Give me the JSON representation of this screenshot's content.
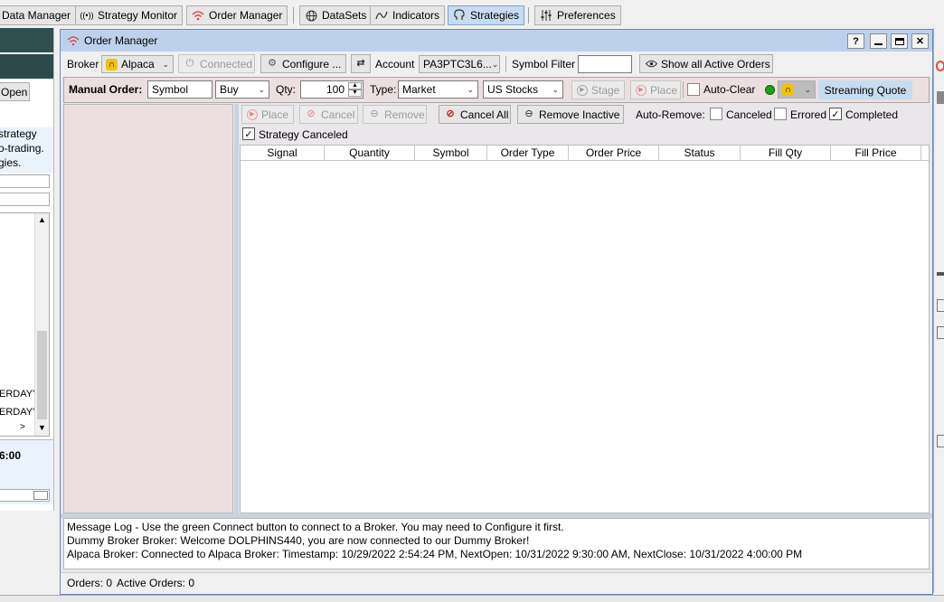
{
  "toolbar": {
    "items": [
      {
        "label": "Data Manager",
        "icon": "database-icon"
      },
      {
        "label": "Strategy Monitor",
        "icon": "broadcast-icon"
      },
      {
        "label": "Order Manager",
        "icon": "wifi-icon"
      },
      {
        "label": "DataSets",
        "icon": "globe-icon"
      },
      {
        "label": "Indicators",
        "icon": "wave-icon"
      },
      {
        "label": "Strategies",
        "icon": "brain-icon"
      },
      {
        "label": "Preferences",
        "icon": "sliders-icon"
      }
    ],
    "active": "Strategies"
  },
  "background_panel": {
    "open_button": "Open",
    "text_lines": [
      "strategy",
      "o-trading.",
      "gies."
    ],
    "list_items": [
      "ERDAY'",
      "ERDAY'"
    ],
    "time_text": "6:00"
  },
  "window": {
    "title": "Order Manager",
    "help_button": "?",
    "broker_row": {
      "broker_label": "Broker",
      "broker_value": "Alpaca",
      "connected_button": "Connected",
      "configure_button": "Configure ...",
      "account_label": "Account",
      "account_value": "PA3PTC3L6...",
      "symbol_filter_label": "Symbol Filter",
      "symbol_filter_value": "",
      "show_all_button": "Show all Active Orders"
    },
    "manual_order": {
      "label": "Manual Order:",
      "symbol_value": "Symbol",
      "side_value": "Buy",
      "qty_label": "Qty:",
      "qty_value": "100",
      "type_label": "Type:",
      "type_value": "Market",
      "market_value": "US Stocks",
      "stage_button": "Stage",
      "place_button": "Place",
      "auto_clear_label": "Auto-Clear",
      "streaming_quote_button": "Streaming Quote"
    },
    "orders_toolbar": {
      "place_button": "Place",
      "cancel_button": "Cancel",
      "remove_button": "Remove",
      "cancel_all_button": "Cancel All",
      "remove_inactive_button": "Remove Inactive",
      "auto_remove_label": "Auto-Remove:",
      "canceled_label": "Canceled",
      "canceled_checked": false,
      "errored_label": "Errored",
      "errored_checked": false,
      "completed_label": "Completed",
      "completed_checked": true,
      "strategy_canceled_label": "Strategy Canceled",
      "strategy_canceled_checked": true
    },
    "table": {
      "columns": [
        "Signal",
        "Quantity",
        "Symbol",
        "Order Type",
        "Order Price",
        "Status",
        "Fill Qty",
        "Fill Price"
      ],
      "rows": []
    },
    "message_log": [
      "Message Log - Use the green Connect button to connect to a Broker. You may need to Configure it first.",
      "Dummy Broker Broker: Welcome DOLPHINS440, you are now connected to our Dummy Broker!",
      "Alpaca Broker: Connected to Alpaca Broker: Timestamp: 10/29/2022 2:54:24 PM, NextOpen: 10/31/2022 9:30:00 AM, NextClose: 10/31/2022 4:00:00 PM"
    ],
    "status_bar": {
      "orders": "Orders: 0",
      "active_orders": "Active Orders: 0"
    }
  },
  "colors": {
    "title_bar": "#bcd2ec",
    "window_bg": "#eae7ea",
    "left_pane": "#ecdfdf",
    "active_tab": "#c7dcf0",
    "connected_dot": "#1aa31a",
    "alpaca_badge": "#f2c200"
  }
}
